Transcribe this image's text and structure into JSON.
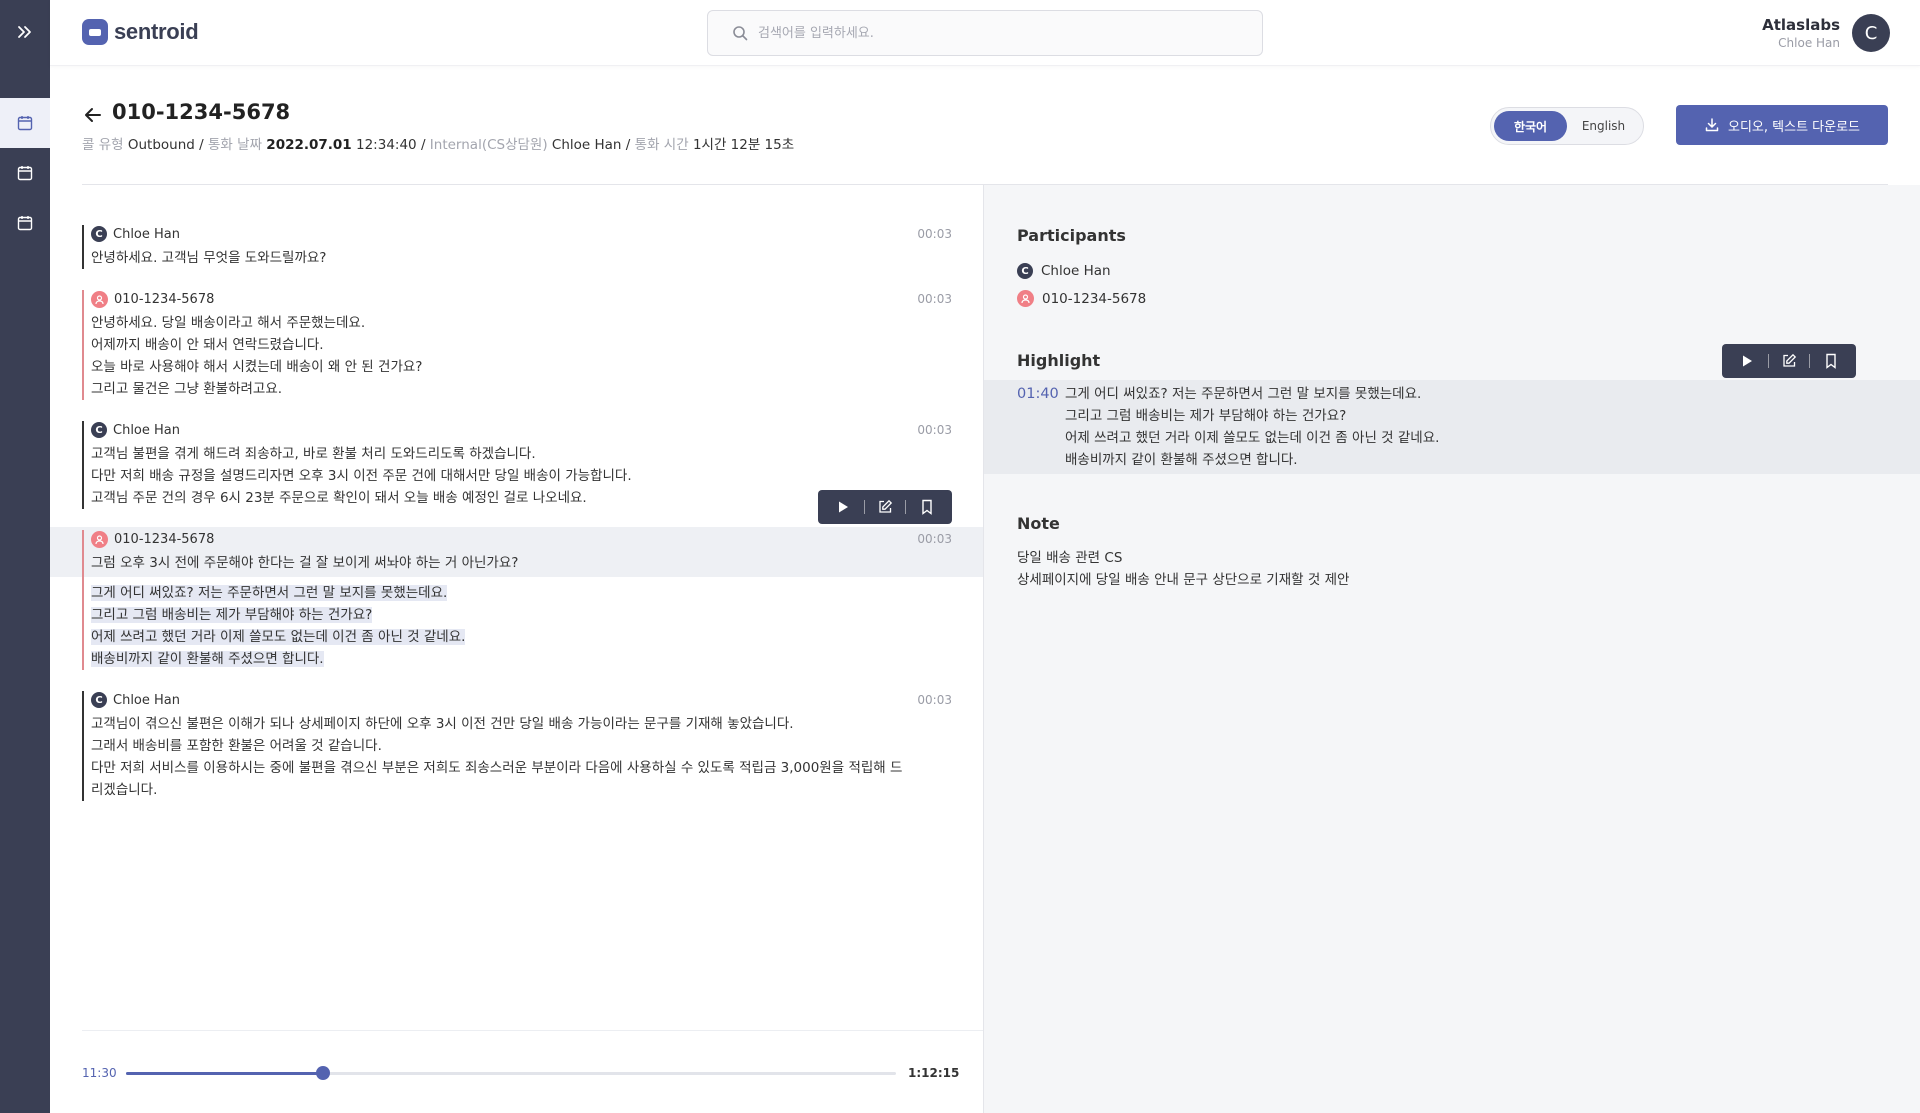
{
  "app": {
    "name": "sentroid"
  },
  "search": {
    "placeholder": "검색어를 입력하세요."
  },
  "user": {
    "org": "Atlaslabs",
    "name": "Chloe Han",
    "initial": "C"
  },
  "call": {
    "title": "010-1234-5678",
    "meta": {
      "type_label": "콜 유형",
      "type_value": "Outbound",
      "date_label": "통화 날짜",
      "date_value": "2022.07.01",
      "time_value": "12:34:40",
      "agent_label": "Internal(CS상담원)",
      "agent_value": "Chloe Han",
      "duration_label": "통화 시간",
      "duration_value": "1시간 12분 15초",
      "sep": "/"
    }
  },
  "lang": {
    "korean": "한국어",
    "english": "English",
    "selected": "한국어"
  },
  "download_label": "오디오, 텍스트 다운로드",
  "transcript": [
    {
      "speaker": "Chloe Han",
      "kind": "agent",
      "initial": "C",
      "time": "00:03",
      "lines": [
        "안녕하세요. 고객님 무엇을 도와드릴까요?"
      ]
    },
    {
      "speaker": "010-1234-5678",
      "kind": "customer",
      "time": "00:03",
      "lines": [
        "안녕하세요. 당일 배송이라고 해서 주문했는데요.",
        "어제까지 배송이 안 돼서 연락드렸습니다.",
        "오늘 바로 사용해야 해서 시켰는데 배송이 왜 안 된 건가요?",
        "그리고 물건은 그냥 환불하려고요."
      ]
    },
    {
      "speaker": "Chloe Han",
      "kind": "agent",
      "initial": "C",
      "time": "00:03",
      "lines": [
        "고객님 불편을 겪게 해드려 죄송하고, 바로 환불 처리 도와드리도록 하겠습니다.",
        "다만 저희 배송 규정을 설명드리자면 오후 3시 이전 주문 건에 대해서만 당일 배송이 가능합니다.",
        "고객님 주문 건의 경우 6시 23분 주문으로 확인이 돼서 오늘 배송 예정인 걸로 나오네요."
      ]
    },
    {
      "speaker": "010-1234-5678",
      "kind": "customer",
      "time": "00:03",
      "lines": [
        "그럼 오후 3시 전에 주문해야 한다는 걸 잘 보이게 써놔야 하는 거 아닌가요?"
      ],
      "selected_lines": [
        "그게 어디 써있죠? 저는 주문하면서 그런 말 보지를 못했는데요.",
        "그리고 그럼 배송비는 제가 부담해야 하는 건가요?",
        "어제 쓰려고 했던 거라 이제 쓸모도 없는데 이건 좀 아닌 것 같네요.",
        "배송비까지 같이 환불해 주셨으면 합니다."
      ]
    },
    {
      "speaker": "Chloe Han",
      "kind": "agent",
      "initial": "C",
      "time": "00:03",
      "lines": [
        "고객님이 겪으신 불편은 이해가 되나 상세페이지 하단에 오후 3시 이전 건만 당일 배송 가능이라는 문구를 기재해 놓았습니다.",
        "그래서 배송비를 포함한 환불은 어려울 것 같습니다.",
        "다만 저희 서비스를 이용하시는 중에 불편을 겪으신 부분은 저희도 죄송스러운 부분이라 다음에 사용하실 수 있도록 적립금 3,000원을 적립해 드",
        "리겠습니다."
      ]
    }
  ],
  "player": {
    "current": "11:30",
    "total": "1:12:15",
    "progress": 0.256
  },
  "participants": {
    "title": "Participants",
    "items": [
      {
        "name": "Chloe Han",
        "kind": "agent",
        "initial": "C"
      },
      {
        "name": "010-1234-5678",
        "kind": "customer"
      }
    ]
  },
  "highlight": {
    "title": "Highlight",
    "time": "01:40",
    "lines": [
      "그게 어디 써있죠? 저는 주문하면서 그런 말 보지를 못했는데요.",
      "그리고 그럼 배송비는 제가 부담해야 하는 건가요?",
      "어제 쓰려고 했던 거라 이제 쓸모도 없는데 이건 좀 아닌 것 같네요.",
      "배송비까지 같이 환불해 주셨으면 합니다."
    ]
  },
  "note": {
    "title": "Note",
    "lines": [
      "당일 배송 관련 CS",
      "상세페이지에 당일 배송 안내 문구 상단으로 기재할 것 제안"
    ]
  },
  "colors": {
    "accent": "#5463b0",
    "rail": "#3a3f54",
    "customer": "#f07f86"
  }
}
